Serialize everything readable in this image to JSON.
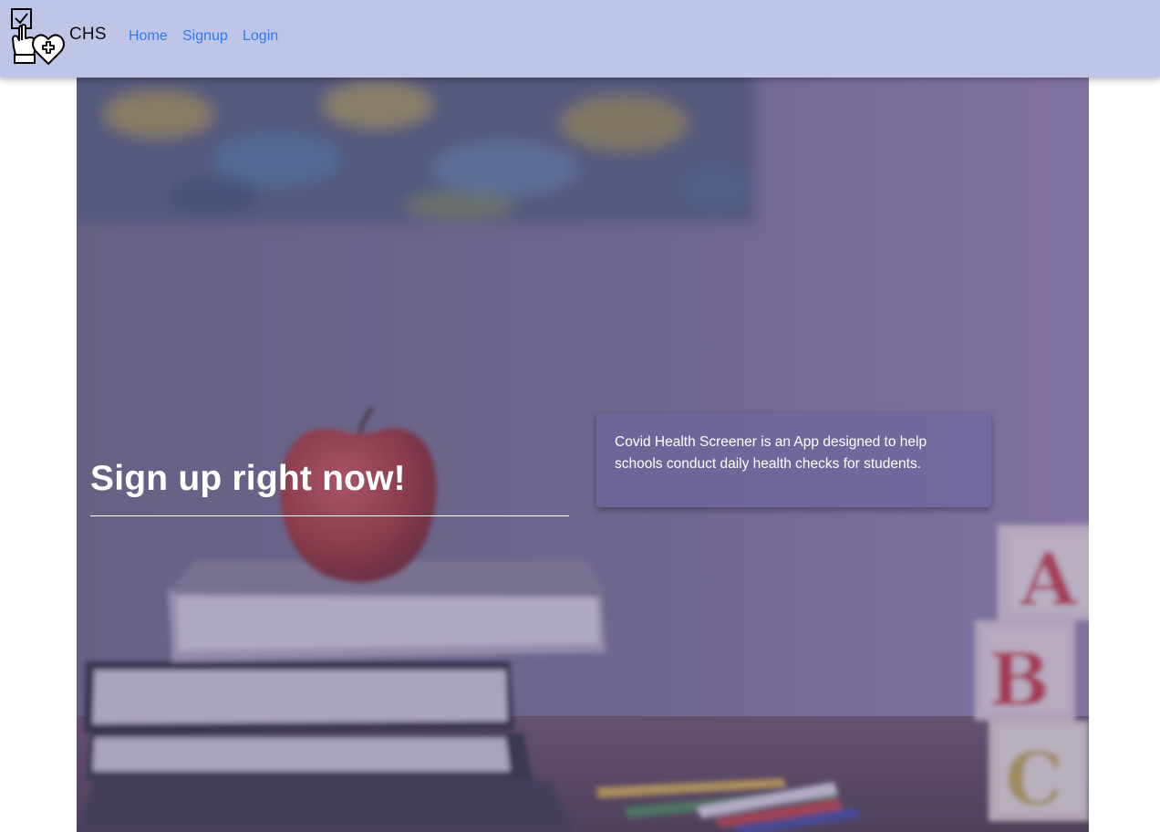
{
  "brand": {
    "logo_icon": "checkbox-hand-heart-medical-icon",
    "name": "CHS"
  },
  "nav": {
    "links": [
      {
        "label": "Home"
      },
      {
        "label": "Signup"
      },
      {
        "label": "Login"
      }
    ]
  },
  "hero": {
    "background_image": "books-apple-abc-blocks-classroom-photo",
    "title": "Sign up right now!",
    "description": "Covid Health Screener is an App designed to help schools conduct daily health checks for students."
  },
  "colors": {
    "navbar_bg": "#bfc5e6",
    "link": "#2f7cf0",
    "overlay": "#6e64a0"
  }
}
